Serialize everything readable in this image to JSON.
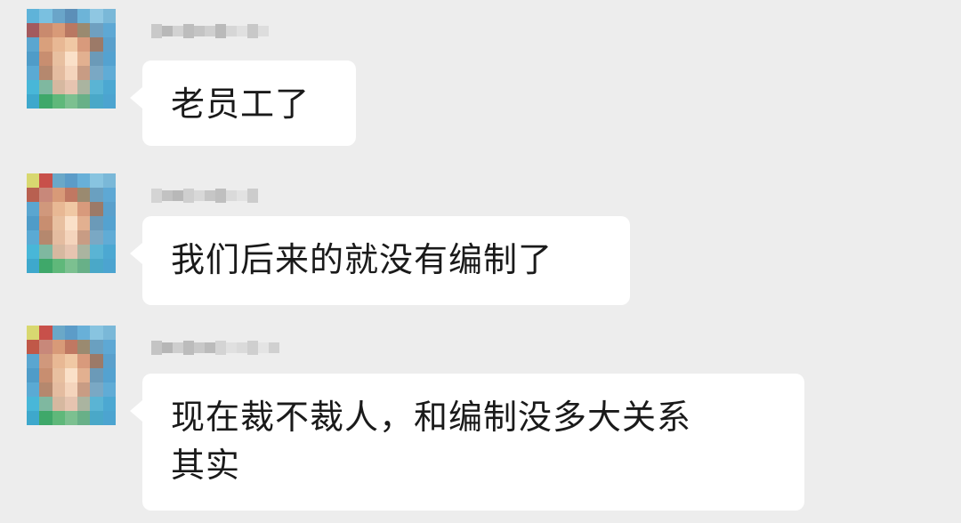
{
  "messages": [
    {
      "sender_name_blurred": true,
      "avatar_blurred": true,
      "lines": [
        "老员工了"
      ]
    },
    {
      "sender_name_blurred": true,
      "avatar_blurred": true,
      "lines": [
        "我们后来的就没有编制了"
      ]
    },
    {
      "sender_name_blurred": true,
      "avatar_blurred": true,
      "lines": [
        "现在裁不裁人，和编制没多大关系",
        "其实"
      ]
    }
  ],
  "colors": {
    "background": "#ededed",
    "bubble": "#ffffff",
    "text": "#1a1a1a"
  }
}
